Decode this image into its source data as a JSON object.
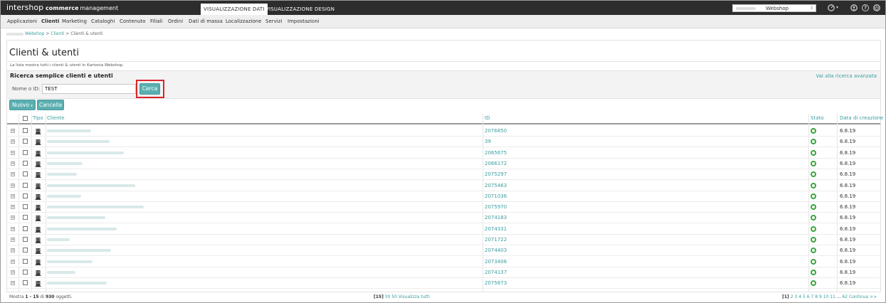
{
  "app": {
    "brand": "intershop",
    "brand_bold": "commerce",
    "brand_rest": "management",
    "view_tabs": [
      "VISUALIZZAZIONE DATI",
      "VISUALIZZAZIONE DESIGN"
    ],
    "site_selector": "Webshop",
    "icons": [
      "dashboard-icon",
      "user-icon",
      "help-icon",
      "power-icon"
    ]
  },
  "nav": [
    "Applicazioni",
    "Clienti",
    "Marketing",
    "Cataloghi",
    "Contenuto",
    "Filiali",
    "Ordini",
    "Dati di massa",
    "Localizzazione",
    "Servizi",
    "Impostazioni"
  ],
  "breadcrumb": {
    "items": [
      "Webshop",
      "Clienti",
      "Clienti & utenti"
    ],
    "sep": ">"
  },
  "page": {
    "title": "Clienti & utenti",
    "description": "La lista mostra tutti i clienti & utenti in Kartonia Webshop."
  },
  "search": {
    "title": "Ricerca semplice clienti e utenti",
    "advanced_link": "Vai alla ricerca avanzata",
    "label": "Nome o ID:",
    "value": "TEST",
    "button": "Cerca"
  },
  "actions": {
    "new_label": "Nuovo",
    "delete_label": "Cancella"
  },
  "table": {
    "columns": {
      "type": "Tipo",
      "customer": "Cliente",
      "id": "ID",
      "status": "Stato",
      "created": "Data di creazione"
    },
    "rows": [
      {
        "id": "2076850",
        "date": "6.8.19",
        "status": "active"
      },
      {
        "id": "39",
        "date": "6.8.19",
        "status": "active"
      },
      {
        "id": "2065675",
        "date": "6.8.19",
        "status": "active"
      },
      {
        "id": "2066172",
        "date": "6.8.19",
        "status": "active"
      },
      {
        "id": "2075297",
        "date": "6.8.19",
        "status": "active"
      },
      {
        "id": "2075463",
        "date": "6.8.19",
        "status": "active"
      },
      {
        "id": "2071036",
        "date": "6.8.19",
        "status": "active"
      },
      {
        "id": "2075970",
        "date": "6.8.19",
        "status": "active"
      },
      {
        "id": "2074183",
        "date": "6.8.19",
        "status": "active"
      },
      {
        "id": "2074331",
        "date": "6.8.19",
        "status": "active"
      },
      {
        "id": "2071722",
        "date": "6.8.19",
        "status": "active"
      },
      {
        "id": "2074403",
        "date": "6.8.19",
        "status": "active"
      },
      {
        "id": "2073406",
        "date": "6.8.19",
        "status": "active"
      },
      {
        "id": "2074137",
        "date": "6.8.19",
        "status": "active"
      },
      {
        "id": "2075673",
        "date": "6.8.19",
        "status": "active"
      }
    ]
  },
  "footer": {
    "show": "Mostra",
    "range": "1 - 15",
    "of": "di",
    "total": "930",
    "items": "oggetti.",
    "page_sizes": [
      "[15]",
      "30",
      "50"
    ],
    "show_all": "Visualizza tutti",
    "current_page": "[1]",
    "pages": [
      "2",
      "3",
      "4",
      "5",
      "6",
      "7",
      "8",
      "9",
      "10",
      "11"
    ],
    "ellipsis": "...",
    "last_page": "62",
    "next": "Continua",
    "next_arrow": ">>"
  },
  "colors": {
    "accent": "#3b9d9e",
    "button": "#5aafb0",
    "highlight": "#d9262b",
    "status": "#3aa43e",
    "topbar": "#2d2d2d"
  }
}
